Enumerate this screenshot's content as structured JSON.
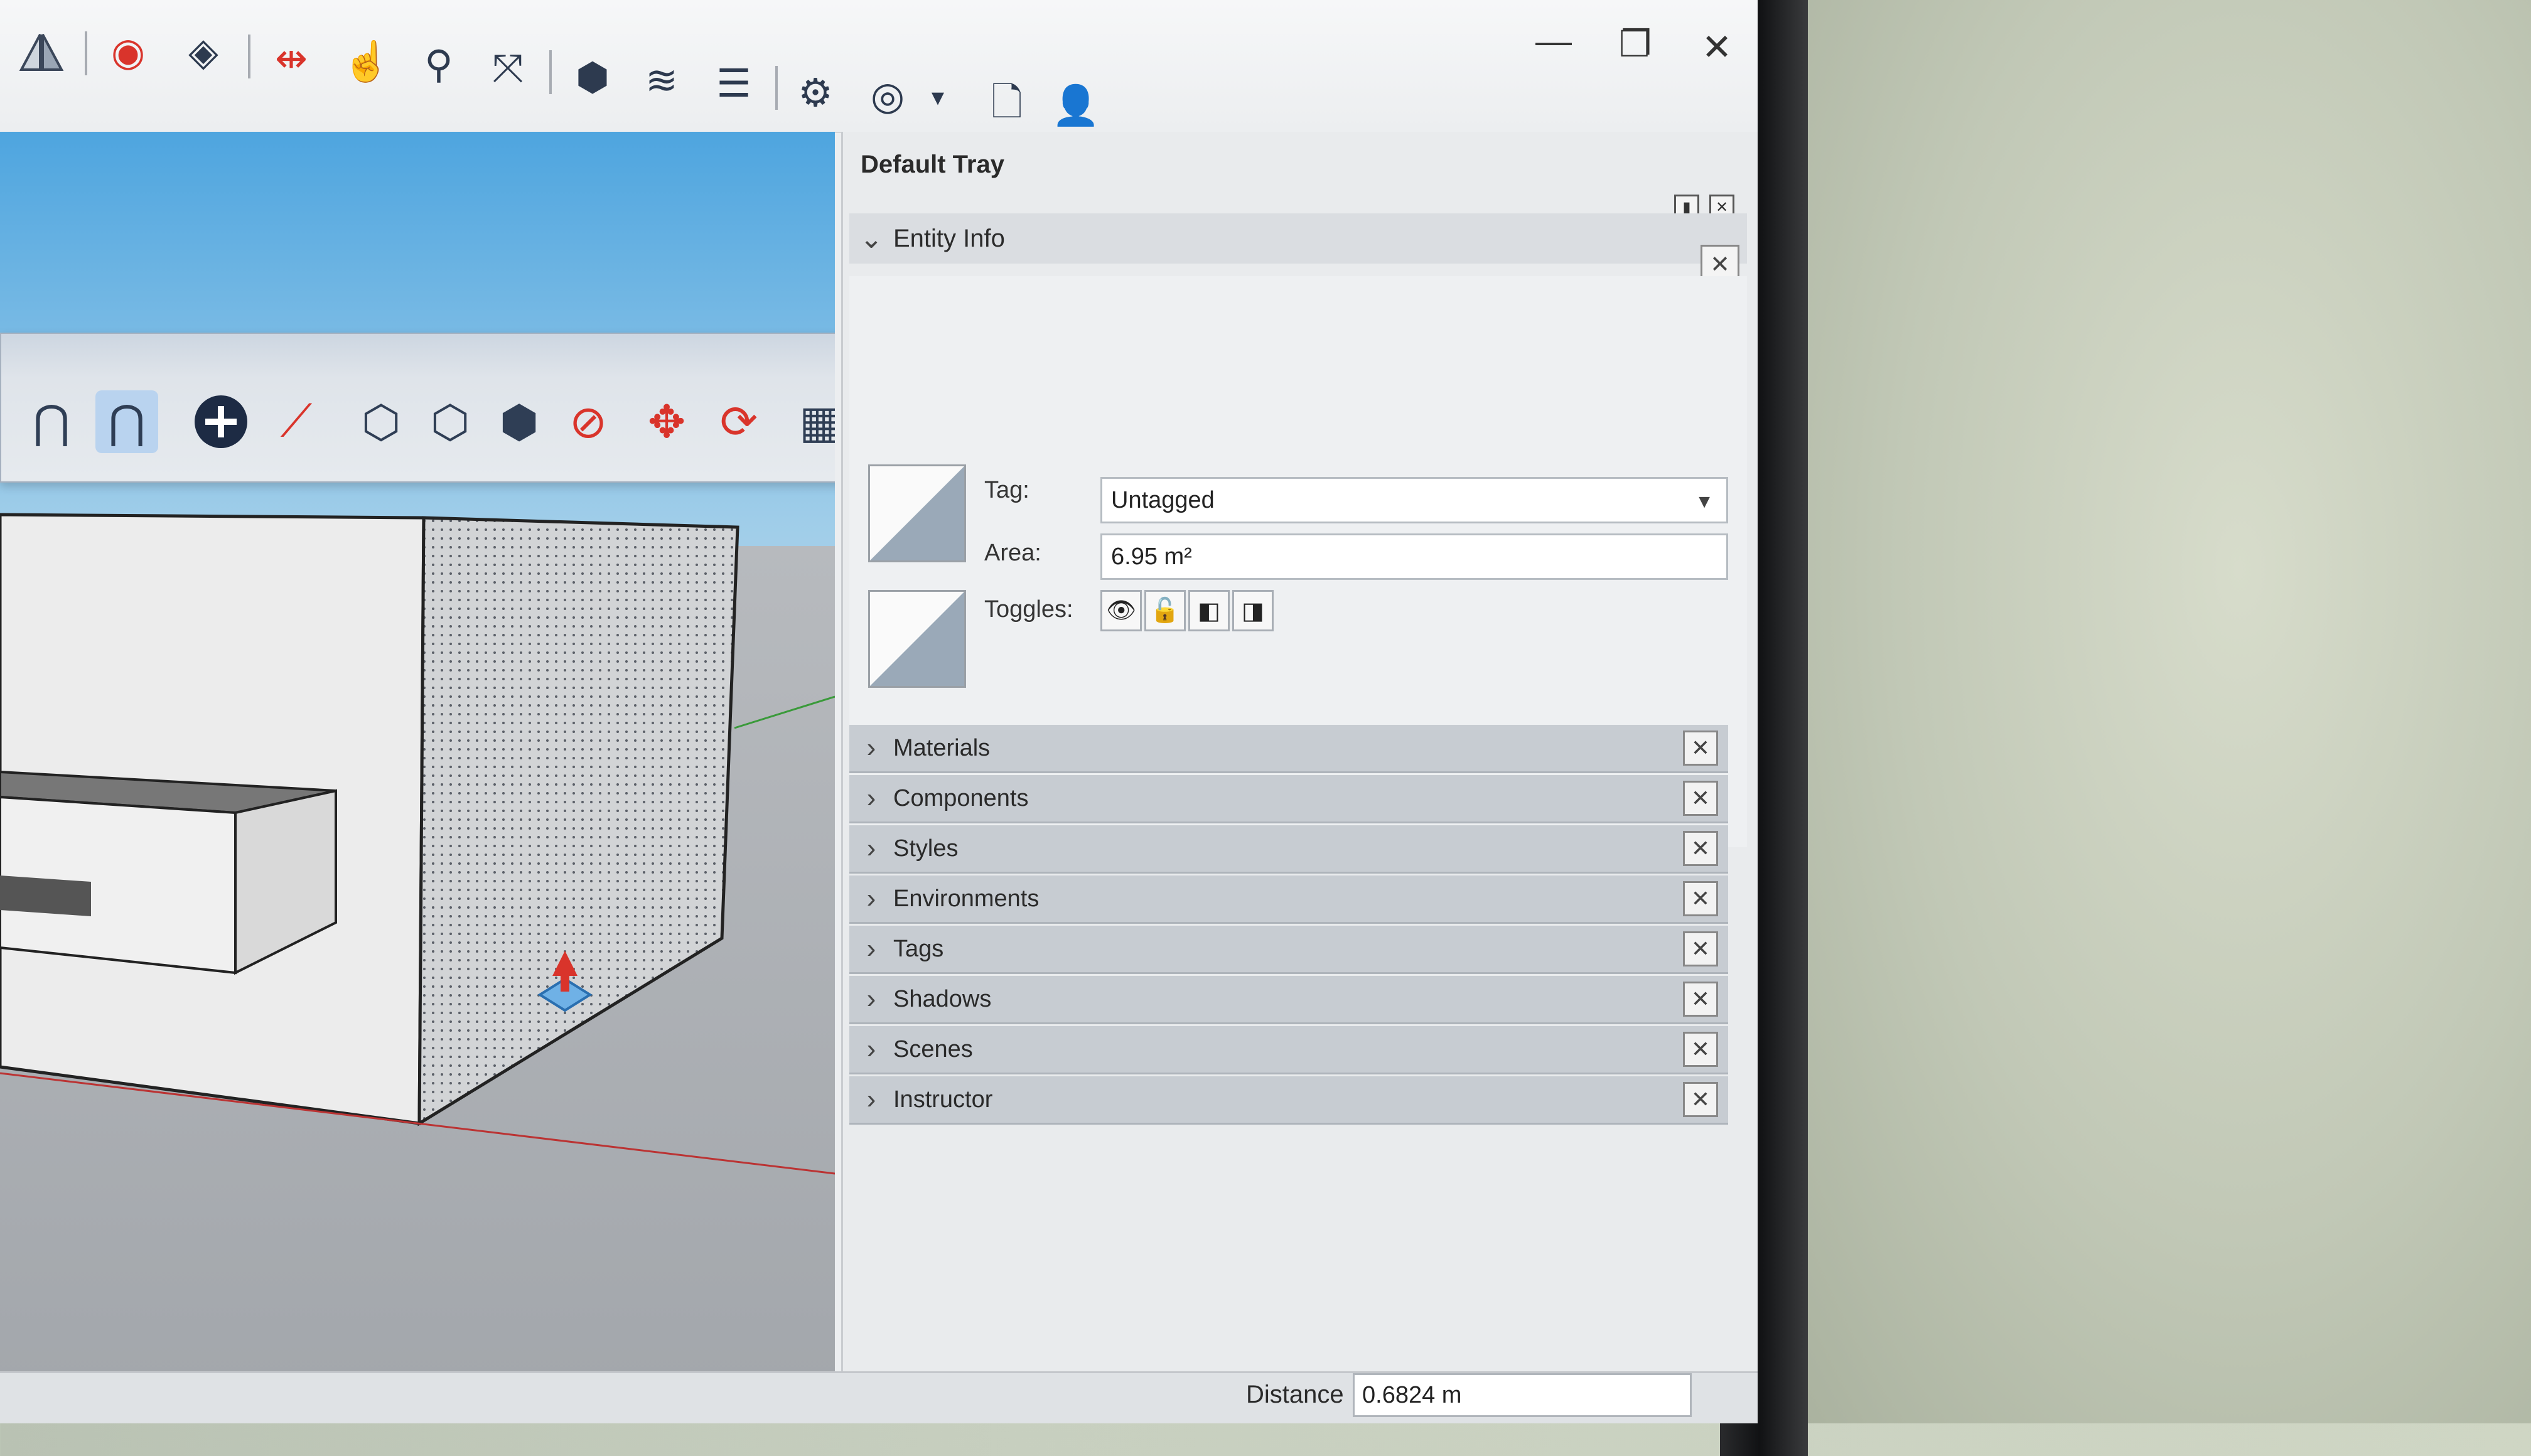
{
  "toolbar": {
    "icons": [
      "tag-icon",
      "geo-pin-icon",
      "paint-icon",
      "section-icon",
      "hand-icon",
      "zoom-icon",
      "zoom-extents-icon",
      "warehouse-icon",
      "layers-icon",
      "layers-add-icon",
      "layers-settings-icon",
      "account-icon",
      "new-file-icon",
      "add-user-icon"
    ]
  },
  "window": {
    "minimize_glyph": "—",
    "restore_glyph": "❐",
    "close_glyph": "✕"
  },
  "floating_toolbar": {
    "close_glyph": "✕"
  },
  "tray": {
    "title": "Default Tray",
    "entity_info": {
      "header": "Entity Info",
      "tag_label": "Tag:",
      "tag_value": "Untagged",
      "area_label": "Area:",
      "area_value": "6.95 m²",
      "toggles_label": "Toggles:"
    },
    "panels": [
      "Materials",
      "Components",
      "Styles",
      "Environments",
      "Tags",
      "Shadows",
      "Scenes",
      "Instructor"
    ]
  },
  "status": {
    "distance_label": "Distance",
    "distance_value": "0.6824 m"
  },
  "colors": {
    "sky": "#4ea5df",
    "panel_header": "#c7ccd2",
    "accent_blue": "#2a7fd4",
    "tool_red": "#d9342b"
  }
}
